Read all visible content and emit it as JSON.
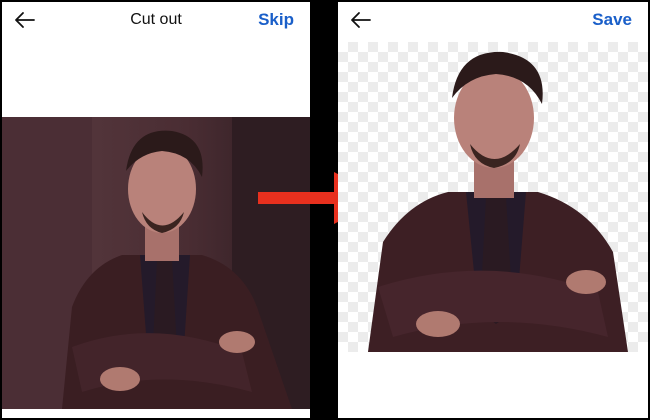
{
  "left_screen": {
    "title": "Cut out",
    "action_label": "Skip",
    "back_icon": "arrow-left-icon"
  },
  "right_screen": {
    "title": "",
    "action_label": "Save",
    "back_icon": "arrow-left-icon"
  },
  "colors": {
    "accent": "#1a5fc9",
    "arrow": "#e8301e",
    "frame": "#000000"
  },
  "transition_icon": "arrow-right-icon"
}
